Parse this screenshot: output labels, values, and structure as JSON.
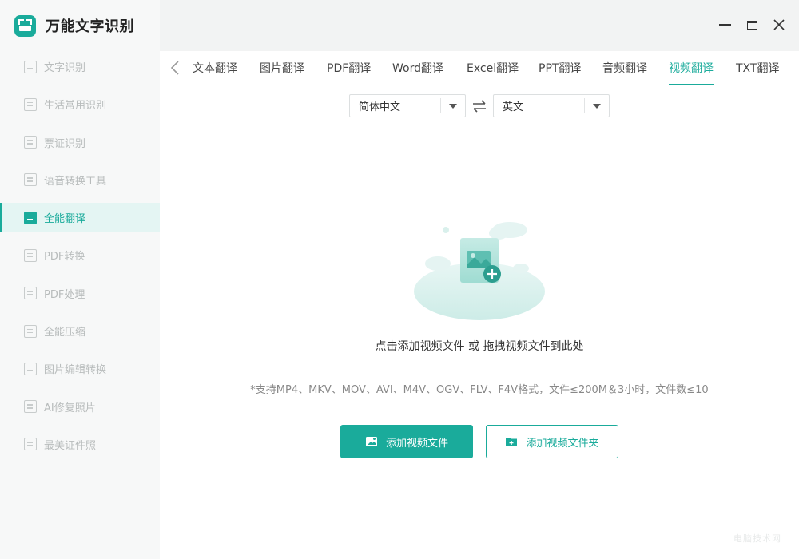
{
  "app": {
    "title": "万能文字识别"
  },
  "sidebar": {
    "items": [
      {
        "label": "文字识别",
        "icon": "scan-text-icon",
        "active": false
      },
      {
        "label": "生活常用识别",
        "icon": "scan-life-icon",
        "active": false
      },
      {
        "label": "票证识别",
        "icon": "ticket-scan-icon",
        "active": false
      },
      {
        "label": "语音转换工具",
        "icon": "voice-convert-icon",
        "active": false
      },
      {
        "label": "全能翻译",
        "icon": "translate-icon",
        "active": true
      },
      {
        "label": "PDF转换",
        "icon": "pdf-convert-icon",
        "active": false
      },
      {
        "label": "PDF处理",
        "icon": "pdf-process-icon",
        "active": false
      },
      {
        "label": "全能压缩",
        "icon": "compress-icon",
        "active": false
      },
      {
        "label": "图片编辑转换",
        "icon": "image-edit-icon",
        "active": false
      },
      {
        "label": "AI修复照片",
        "icon": "photo-repair-icon",
        "active": false
      },
      {
        "label": "最美证件照",
        "icon": "id-photo-icon",
        "active": false
      }
    ]
  },
  "tabs": [
    {
      "label": "文本翻译",
      "active": false
    },
    {
      "label": "图片翻译",
      "active": false
    },
    {
      "label": "PDF翻译",
      "active": false
    },
    {
      "label": "Word翻译",
      "active": false
    },
    {
      "label": "Excel翻译",
      "active": false
    },
    {
      "label": "PPT翻译",
      "active": false
    },
    {
      "label": "音频翻译",
      "active": false
    },
    {
      "label": "视频翻译",
      "active": true
    },
    {
      "label": "TXT翻译",
      "active": false
    }
  ],
  "language": {
    "source": "简体中文",
    "target": "英文"
  },
  "dropzone": {
    "hint": "点击添加视频文件 或 拖拽视频文件到此处",
    "note": "*支持MP4、MKV、MOV、AVI、M4V、OGV、FLV、F4V格式，文件≤200M＆3小时，文件数≤10"
  },
  "buttons": {
    "add_file": "添加视频文件",
    "add_folder": "添加视频文件夹"
  },
  "watermark": "电脑技术网",
  "colors": {
    "accent": "#1aab9b",
    "sidebar_bg": "#f7f8f8",
    "titlebar_bg": "#f2f3f3"
  }
}
